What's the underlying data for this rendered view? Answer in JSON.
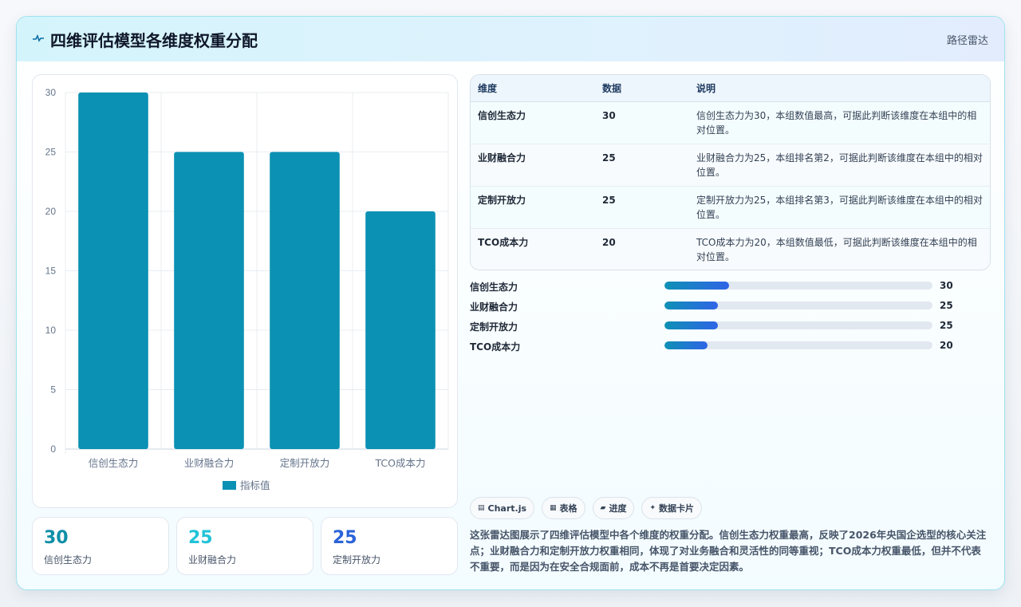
{
  "header": {
    "title": "四维评估模型各维度权重分配",
    "title_icon": "pulse-icon",
    "chip": "路径雷达"
  },
  "chart_data": {
    "type": "bar",
    "categories": [
      "信创生态力",
      "业财融合力",
      "定制开放力",
      "TCO成本力"
    ],
    "series": [
      {
        "name": "指标值",
        "values": [
          30,
          25,
          25,
          20
        ],
        "color": "#0b91b3"
      }
    ],
    "ylim": [
      0,
      30
    ],
    "yticks": [
      0,
      5,
      10,
      15,
      20,
      25,
      30
    ],
    "grid": true,
    "legend": "bottom"
  },
  "stats": [
    {
      "value": "30",
      "label": "信创生态力",
      "color": "#0f8fa8"
    },
    {
      "value": "25",
      "label": "业财融合力",
      "color": "#22c3d8"
    },
    {
      "value": "25",
      "label": "定制开放力",
      "color": "#2b63d9"
    }
  ],
  "table": {
    "headers": [
      "维度",
      "数据",
      "说明"
    ],
    "rows": [
      {
        "name": "信创生态力",
        "value": "30",
        "desc": "信创生态力为30，本组数值最高，可据此判断该维度在本组中的相对位置。"
      },
      {
        "name": "业财融合力",
        "value": "25",
        "desc": "业财融合力为25，本组排名第2，可据此判断该维度在本组中的相对位置。"
      },
      {
        "name": "定制开放力",
        "value": "25",
        "desc": "定制开放力为25，本组排名第3，可据此判断该维度在本组中的相对位置。"
      },
      {
        "name": "TCO成本力",
        "value": "20",
        "desc": "TCO成本力为20，本组数值最低，可据此判断该维度在本组中的相对位置。"
      }
    ]
  },
  "progress": [
    {
      "label": "信创生态力",
      "value": "30",
      "fraction": 0.24
    },
    {
      "label": "业财融合力",
      "value": "25",
      "fraction": 0.2
    },
    {
      "label": "定制开放力",
      "value": "25",
      "fraction": 0.2
    },
    {
      "label": "TCO成本力",
      "value": "20",
      "fraction": 0.16
    }
  ],
  "tags": [
    {
      "icon": "chart-icon",
      "glyph": "▤",
      "label": "Chart.js"
    },
    {
      "icon": "table-icon",
      "glyph": "▦",
      "label": "表格"
    },
    {
      "icon": "progress-icon",
      "glyph": "▰",
      "label": "进度"
    },
    {
      "icon": "card-icon",
      "glyph": "✦",
      "label": "数据卡片"
    }
  ],
  "summary": "这张雷达图展示了四维评估模型中各个维度的权重分配。信创生态力权重最高，反映了2026年央国企选型的核心关注点；业财融合力和定制开放力权重相同，体现了对业务融合和灵活性的同等重视；TCO成本力权重最低，但并不代表不重要，而是因为在安全合规面前，成本不再是首要决定因素。"
}
